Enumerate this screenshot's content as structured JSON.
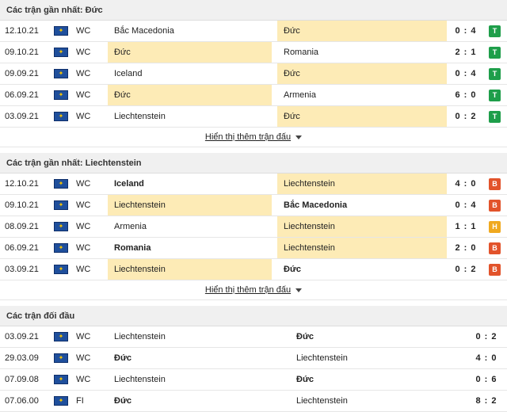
{
  "section1": {
    "title": "Các trận gần nhất: Đức",
    "rows": [
      {
        "date": "12.10.21",
        "league": "WC",
        "home": "Bắc Macedonia",
        "away": "Đức",
        "score": "0 : 4",
        "result": "T",
        "hl": "away",
        "bold": ""
      },
      {
        "date": "09.10.21",
        "league": "WC",
        "home": "Đức",
        "away": "Romania",
        "score": "2 : 1",
        "result": "T",
        "hl": "home",
        "bold": ""
      },
      {
        "date": "09.09.21",
        "league": "WC",
        "home": "Iceland",
        "away": "Đức",
        "score": "0 : 4",
        "result": "T",
        "hl": "away",
        "bold": ""
      },
      {
        "date": "06.09.21",
        "league": "WC",
        "home": "Đức",
        "away": "Armenia",
        "score": "6 : 0",
        "result": "T",
        "hl": "home",
        "bold": ""
      },
      {
        "date": "03.09.21",
        "league": "WC",
        "home": "Liechtenstein",
        "away": "Đức",
        "score": "0 : 2",
        "result": "T",
        "hl": "away",
        "bold": ""
      }
    ],
    "more_label": "Hiển thị thêm trận đấu"
  },
  "section2": {
    "title": "Các trận gần nhất: Liechtenstein",
    "rows": [
      {
        "date": "12.10.21",
        "league": "WC",
        "home": "Iceland",
        "away": "Liechtenstein",
        "score": "4 : 0",
        "result": "B",
        "hl": "away",
        "bold": "home"
      },
      {
        "date": "09.10.21",
        "league": "WC",
        "home": "Liechtenstein",
        "away": "Bắc Macedonia",
        "score": "0 : 4",
        "result": "B",
        "hl": "home",
        "bold": "away"
      },
      {
        "date": "08.09.21",
        "league": "WC",
        "home": "Armenia",
        "away": "Liechtenstein",
        "score": "1 : 1",
        "result": "H",
        "hl": "away",
        "bold": ""
      },
      {
        "date": "06.09.21",
        "league": "WC",
        "home": "Romania",
        "away": "Liechtenstein",
        "score": "2 : 0",
        "result": "B",
        "hl": "away",
        "bold": "home"
      },
      {
        "date": "03.09.21",
        "league": "WC",
        "home": "Liechtenstein",
        "away": "Đức",
        "score": "0 : 2",
        "result": "B",
        "hl": "home",
        "bold": "away"
      }
    ],
    "more_label": "Hiển thị thêm trận đấu"
  },
  "section3": {
    "title": "Các trận đối đầu",
    "rows": [
      {
        "date": "03.09.21",
        "league": "WC",
        "home": "Liechtenstein",
        "away": "Đức",
        "score": "0 : 2",
        "bold": "away"
      },
      {
        "date": "29.03.09",
        "league": "WC",
        "home": "Đức",
        "away": "Liechtenstein",
        "score": "4 : 0",
        "bold": "home"
      },
      {
        "date": "07.09.08",
        "league": "WC",
        "home": "Liechtenstein",
        "away": "Đức",
        "score": "0 : 6",
        "bold": "away"
      },
      {
        "date": "07.06.00",
        "league": "FI",
        "home": "Đức",
        "away": "Liechtenstein",
        "score": "8 : 2",
        "bold": "home"
      }
    ]
  },
  "icons": {
    "league_flag": "world-map-icon",
    "more_caret": "caret-down-icon"
  },
  "colors": {
    "highlight": "#fdebb6",
    "win": "#1e9e4a",
    "loss": "#e2532b",
    "draw": "#f0a920",
    "flag": "#1f4f9c"
  }
}
